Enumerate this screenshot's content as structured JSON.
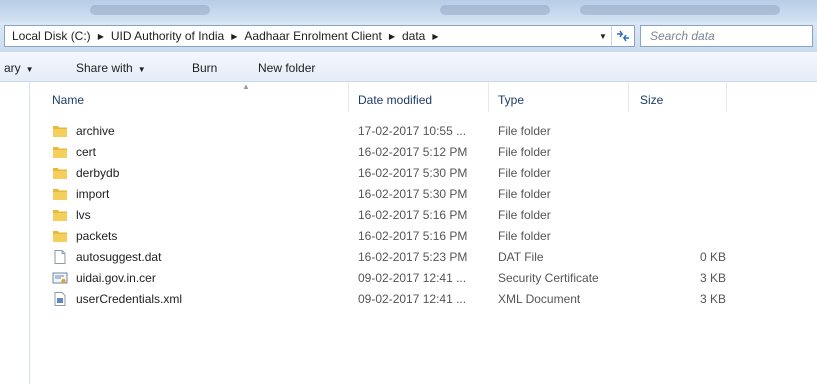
{
  "address": {
    "crumbs": [
      "Local Disk (C:)",
      "UID Authority of India",
      "Aadhaar Enrolment Client",
      "data"
    ],
    "search_placeholder": "Search data"
  },
  "toolbar": {
    "library_label": "ary",
    "share_label": "Share with",
    "burn_label": "Burn",
    "new_folder_label": "New folder"
  },
  "columns": {
    "name": "Name",
    "date": "Date modified",
    "type": "Type",
    "size": "Size"
  },
  "files": [
    {
      "name": "archive",
      "date": "17-02-2017 10:55 ...",
      "type": "File folder",
      "size": "",
      "icon": "folder-icon"
    },
    {
      "name": "cert",
      "date": "16-02-2017 5:12 PM",
      "type": "File folder",
      "size": "",
      "icon": "folder-icon"
    },
    {
      "name": "derbydb",
      "date": "16-02-2017 5:30 PM",
      "type": "File folder",
      "size": "",
      "icon": "folder-icon"
    },
    {
      "name": "import",
      "date": "16-02-2017 5:30 PM",
      "type": "File folder",
      "size": "",
      "icon": "folder-icon"
    },
    {
      "name": "lvs",
      "date": "16-02-2017 5:16 PM",
      "type": "File folder",
      "size": "",
      "icon": "folder-icon"
    },
    {
      "name": "packets",
      "date": "16-02-2017 5:16 PM",
      "type": "File folder",
      "size": "",
      "icon": "folder-icon"
    },
    {
      "name": "autosuggest.dat",
      "date": "16-02-2017 5:23 PM",
      "type": "DAT File",
      "size": "0 KB",
      "icon": "file-icon"
    },
    {
      "name": "uidai.gov.in.cer",
      "date": "09-02-2017 12:41 ...",
      "type": "Security Certificate",
      "size": "3 KB",
      "icon": "certificate-icon"
    },
    {
      "name": "userCredentials.xml",
      "date": "09-02-2017 12:41 ...",
      "type": "XML Document",
      "size": "3 KB",
      "icon": "xml-file-icon"
    }
  ]
}
